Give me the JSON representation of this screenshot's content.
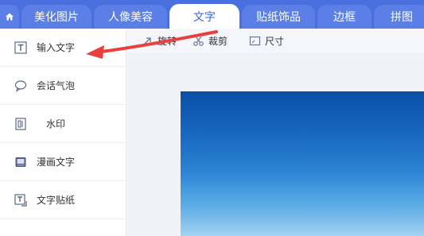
{
  "tabs": [
    {
      "label": "美化图片",
      "active": false
    },
    {
      "label": "人像美容",
      "active": false
    },
    {
      "label": "文字",
      "active": true
    },
    {
      "label": "贴纸饰品",
      "active": false
    },
    {
      "label": "边框",
      "active": false
    },
    {
      "label": "拼图",
      "active": false
    }
  ],
  "sidebar": {
    "items": [
      {
        "label": "输入文字",
        "icon": "text-t-icon",
        "active": true
      },
      {
        "label": "会话气泡",
        "icon": "speech-bubble-icon",
        "active": false
      },
      {
        "label": "水印",
        "icon": "watermark-icon",
        "active": false
      },
      {
        "label": "漫画文字",
        "icon": "comic-book-icon",
        "active": false
      },
      {
        "label": "文字贴纸",
        "icon": "text-sticker-icon",
        "active": false
      }
    ]
  },
  "toolbar": {
    "rotate_label": "旋转",
    "crop_label": "裁剪",
    "size_label": "尺寸"
  },
  "colors": {
    "tabbar": "#4a70df",
    "tab": "#5b7fe6",
    "active_tab_text": "#3f66d8",
    "arrow": "#e8413d"
  }
}
